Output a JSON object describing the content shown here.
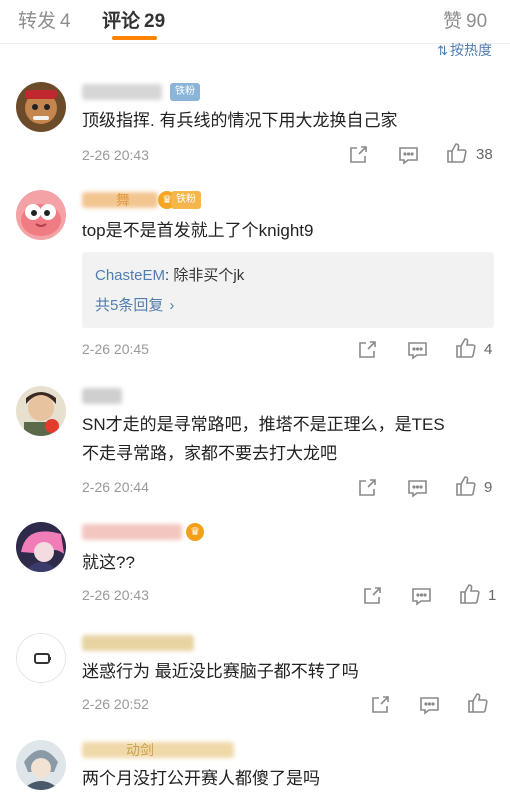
{
  "tabs": [
    {
      "label": "转发",
      "count": "4"
    },
    {
      "label": "评论",
      "count": "29"
    },
    {
      "label": "赞",
      "count": "90"
    }
  ],
  "sort": {
    "icon": "sort-icon",
    "label": "按热度"
  },
  "comments": [
    {
      "badge": "铁粉",
      "text": [
        "顶级指挥. 有兵线的情况下用大龙换自己家"
      ],
      "time": "2-26 20:43",
      "likes": "38"
    },
    {
      "badge": "铁粉",
      "name_fragment": "舞",
      "text": [
        "top是不是首发就上了个knight9"
      ],
      "time": "2-26 20:45",
      "likes": "4",
      "reply": {
        "user": "ChasteEM",
        "text": ": 除非买个jk",
        "more": "共5条回复"
      }
    },
    {
      "text": [
        "SN才走的是寻常路吧，推塔不是正理么，是TES",
        "不走寻常路，家都不要去打大龙吧"
      ],
      "time": "2-26 20:44",
      "likes": "9"
    },
    {
      "text": [
        "就这??"
      ],
      "time": "2-26 20:43",
      "likes": "1"
    },
    {
      "text": [
        "迷惑行为 最近没比赛脑子都不转了吗"
      ],
      "time": "2-26 20:52",
      "likes": ""
    },
    {
      "name_fragment": "动剑",
      "text": [
        "两个月没打公开赛人都傻了是吗"
      ]
    }
  ],
  "icons": {
    "share": "share-icon",
    "comment": "comment-icon",
    "like": "like-icon"
  },
  "colors": {
    "accent": "#ff8200",
    "link": "#507daf"
  }
}
